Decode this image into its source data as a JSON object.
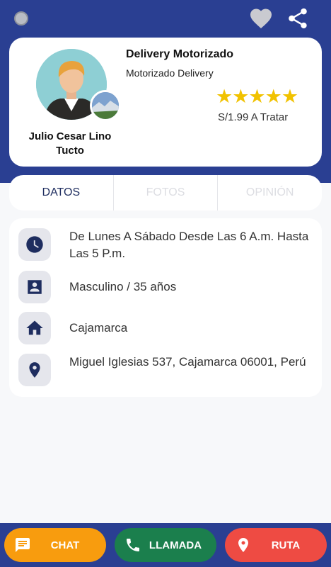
{
  "header": {
    "favorite_icon": "heart-icon",
    "share_icon": "share-icon"
  },
  "profile": {
    "name": "Julio Cesar Lino Tucto",
    "service_title": "Delivery Motorizado",
    "service_subtitle": "Motorizado Delivery",
    "rating_stars": "★★★★★",
    "rating": 5,
    "price": "S/1.99 A Tratar"
  },
  "tabs": [
    {
      "label": "DATOS",
      "active": true
    },
    {
      "label": "FOTOS",
      "active": false
    },
    {
      "label": "OPINIÓN",
      "active": false
    }
  ],
  "info": {
    "schedule": "De Lunes A Sábado Desde Las 6 A.m. Hasta Las 5 P.m.",
    "gender_age": "Masculino / 35 años",
    "city": "Cajamarca",
    "address": "Miguel Iglesias 537, Cajamarca 06001, Perú"
  },
  "actions": {
    "chat": "CHAT",
    "call": "LLAMADA",
    "route": "RUTA"
  },
  "colors": {
    "brand": "#2a3f92",
    "chat": "#f89c0e",
    "call": "#1b7f4d",
    "route": "#ee4b43",
    "stars": "#f1c200"
  }
}
